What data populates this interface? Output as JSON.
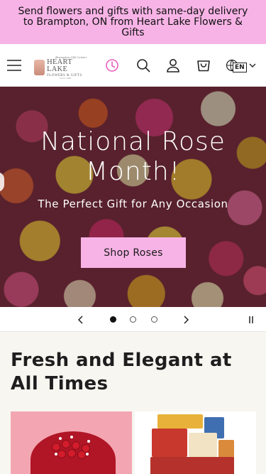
{
  "announcement": {
    "text": "Send flowers and gifts with same-day delivery to Brampton, ON from Heart Lake Flowers & Gifts"
  },
  "header": {
    "logo": {
      "top_line": "Brampton Gift Center",
      "name": "HEART LAKE",
      "sub": "FLOWERS & GIFTS",
      "tiny": "Since 1981"
    },
    "language": "EN",
    "accent_color": "#e85fbf"
  },
  "hero": {
    "title": "National Rose Month!",
    "subtitle": "The Perfect Gift for Any Occasion",
    "button_label": "Shop Roses",
    "button_color": "#f7b3e6"
  },
  "slider": {
    "slide_count": 3,
    "active_slide": 1
  },
  "featured": {
    "title": "Fresh and Elegant at All Times"
  },
  "colors": {
    "announcement_bg": "#f7b3e6",
    "section_bg": "#f8f6f1"
  }
}
